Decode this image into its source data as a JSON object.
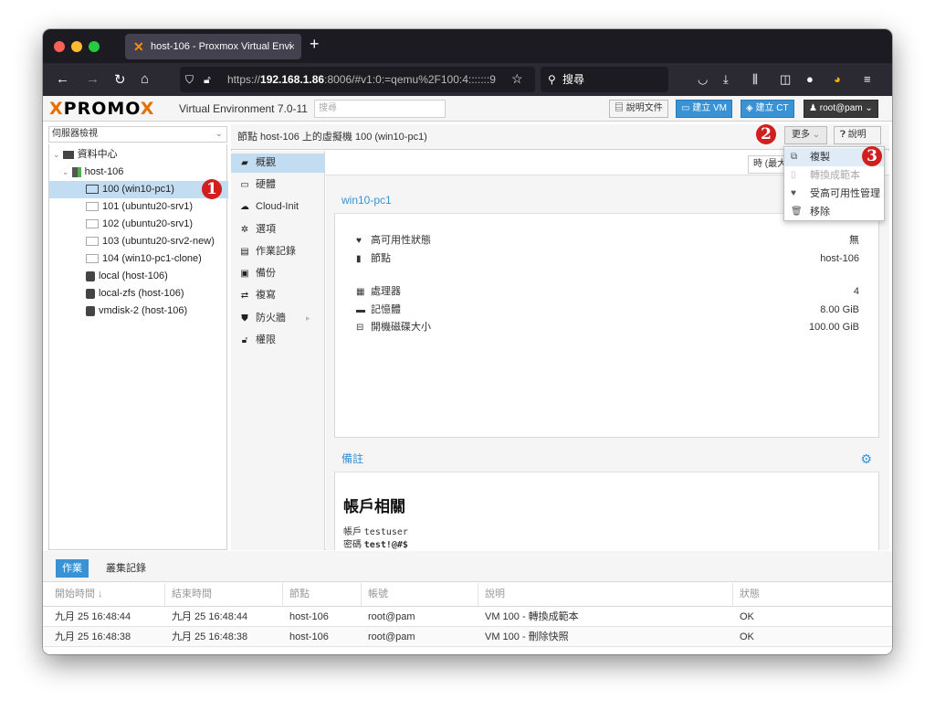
{
  "browser": {
    "tab_title": "host-106 - Proxmox Virtual Envi",
    "tab_close": "×",
    "new_tab": "+",
    "url_prefix": "https://",
    "url_host": "192.168.1.86",
    "url_rest": ":8006/#v1:0:=qemu%2F100:4:::::::9",
    "search_label": "搜尋"
  },
  "header": {
    "logo_prefix": "PRO",
    "logo_mid": "MO",
    "logo_x": "X",
    "version": "Virtual Environment 7.0-11",
    "search_placeholder": "搜尋",
    "docs_label": "說明文件",
    "create_vm_label": "建立 VM",
    "create_ct_label": "建立 CT",
    "user_label": "root@pam"
  },
  "sidebar": {
    "view_label": "伺服器檢視",
    "items": [
      {
        "label": "資料中心"
      },
      {
        "label": "host-106"
      },
      {
        "label": "100 (win10-pc1)"
      },
      {
        "label": "101 (ubuntu20-srv1)"
      },
      {
        "label": "102 (ubuntu20-srv1)"
      },
      {
        "label": "103 (ubuntu20-srv2-new)"
      },
      {
        "label": "104 (win10-pc1-clone)"
      },
      {
        "label": "local (host-106)"
      },
      {
        "label": "local-zfs (host-106)"
      },
      {
        "label": "vmdisk-2 (host-106)"
      }
    ]
  },
  "panel": {
    "title": "節點 host-106 上的虛擬機 100 (win10-pc1)",
    "more_label": "更多",
    "help_label": "說明",
    "time_select": "時 (最大"
  },
  "nav": {
    "items": [
      {
        "label": "概觀"
      },
      {
        "label": "硬體"
      },
      {
        "label": "Cloud-Init"
      },
      {
        "label": "選項"
      },
      {
        "label": "作業記錄"
      },
      {
        "label": "備份"
      },
      {
        "label": "複寫"
      },
      {
        "label": "防火牆"
      },
      {
        "label": "權限"
      }
    ]
  },
  "more_menu": {
    "items": [
      {
        "label": "複製"
      },
      {
        "label": "轉換成範本"
      },
      {
        "label": "受高可用性管理"
      },
      {
        "label": "移除"
      }
    ]
  },
  "summary": {
    "vm_name": "win10-pc1",
    "rows": [
      {
        "label": "高可用性狀態",
        "value": "無"
      },
      {
        "label": "節點",
        "value": "host-106"
      },
      {
        "label": "處理器",
        "value": "4"
      },
      {
        "label": "記憶體",
        "value": "8.00 GiB"
      },
      {
        "label": "開機磁碟大小",
        "value": "100.00 GiB"
      }
    ]
  },
  "notes": {
    "title": "備註",
    "heading": "帳戶相關",
    "account_label": "帳戶",
    "account_value": "testuser",
    "password_label": "密碼",
    "password_value": "test!@#$"
  },
  "bottom": {
    "tabs": [
      "作業",
      "叢集記錄"
    ],
    "columns": [
      "開始時間 ↓",
      "結束時間",
      "節點",
      "帳號",
      "說明",
      "狀態"
    ],
    "rows": [
      {
        "start": "九月 25 16:48:44",
        "end": "九月 25 16:48:44",
        "node": "host-106",
        "user": "root@pam",
        "desc": "VM 100 - 轉換成範本",
        "status": "OK"
      },
      {
        "start": "九月 25 16:48:38",
        "end": "九月 25 16:48:38",
        "node": "host-106",
        "user": "root@pam",
        "desc": "VM 100 - 刪除快照",
        "status": "OK"
      }
    ]
  },
  "badges": [
    "1",
    "2",
    "3"
  ],
  "colors": {
    "accent_blue": "#3892d4",
    "selection": "#c2ddf2",
    "proxmox_orange": "#e57000",
    "badge_red": "#d11f1f"
  }
}
